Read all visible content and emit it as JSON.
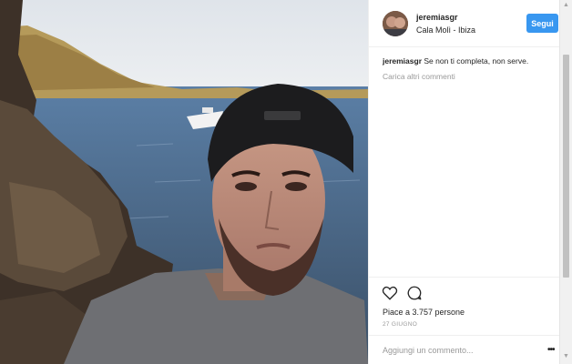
{
  "post": {
    "username": "jeremiasgr",
    "location": "Cala Molì - Ibiza",
    "follow_label": "Segui",
    "caption_user": "jeremiasgr",
    "caption_text": "Se non ti completa, non serve.",
    "load_more_label": "Carica altri commenti",
    "likes_text": "Piace a 3.757 persone",
    "date": "27 GIUGNO",
    "comment_placeholder": "Aggiungi un commento..."
  },
  "icons": {
    "like": "heart-icon",
    "comment": "comment-icon",
    "more": "more-options-icon"
  },
  "colors": {
    "follow_button": "#3897f0",
    "muted_text": "#999999",
    "primary_text": "#262626"
  }
}
